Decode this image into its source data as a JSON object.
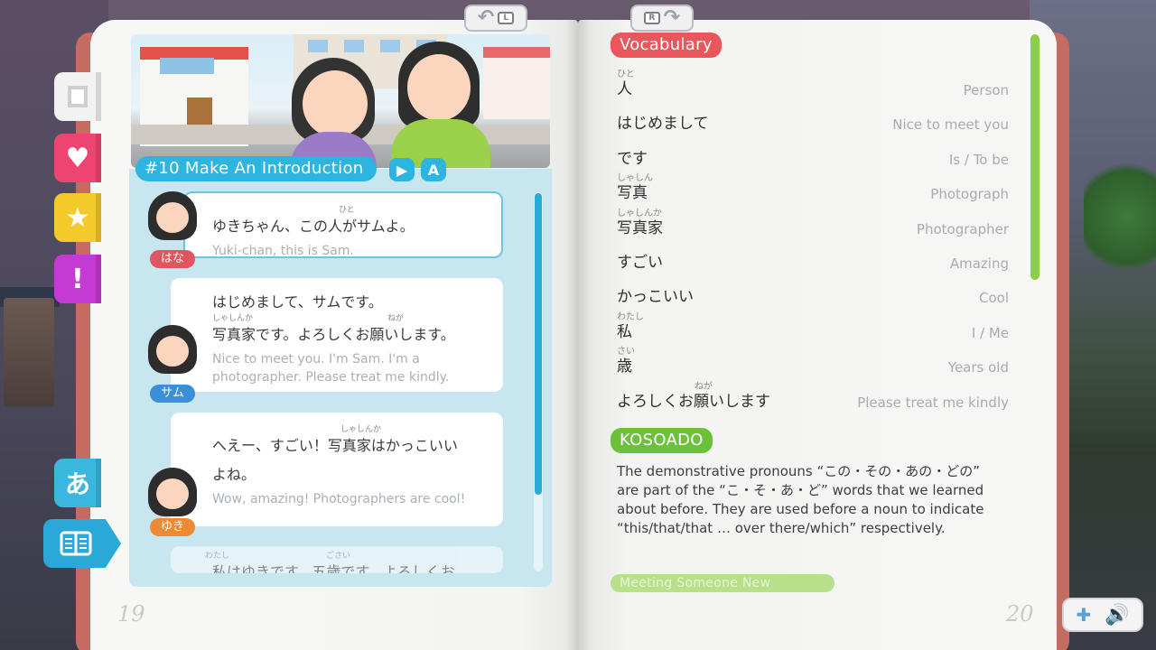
{
  "nav": {
    "prev_key": "L",
    "next_key": "R"
  },
  "side_tabs": {
    "kana_label": "あ"
  },
  "lesson": {
    "title": "#10 Make An Introduction",
    "play_label": "▶",
    "font_label": "A"
  },
  "dialogue": [
    {
      "speaker": "はな",
      "ruby": "ひと",
      "jp": "ゆきちゃん、この人がサムよ。",
      "en": "Yuki-chan, this is Sam."
    },
    {
      "speaker": "サム",
      "jp_line1": "はじめまして、サムです。",
      "ruby_a": "しゃしんか",
      "ruby_b": "ねが",
      "jp_line2": "写真家です。よろしくお願いします。",
      "en": "Nice to meet you. I'm Sam. I'm a photographer. Please treat me kindly."
    },
    {
      "speaker": "ゆき",
      "ruby": "しゃしんか",
      "jp_line1": "へえー、すごい！写真家はかっこいい",
      "jp_line2": "よね。",
      "en": "Wow, amazing! Photographers are cool!"
    },
    {
      "ruby_a": "わたし",
      "ruby_b": "ごさい",
      "jp": "私はゆきです。五歳です。よろしくお"
    }
  ],
  "vocabulary": {
    "heading": "Vocabulary",
    "items": [
      {
        "ruby": "ひと",
        "jp": "人",
        "en": "Person"
      },
      {
        "ruby": "",
        "jp": "はじめまして",
        "en": "Nice to meet you"
      },
      {
        "ruby": "",
        "jp": "です",
        "en": "Is / To be"
      },
      {
        "ruby": "しゃしん",
        "jp": "写真",
        "en": "Photograph"
      },
      {
        "ruby": "しゃしんか",
        "jp": "写真家",
        "en": "Photographer"
      },
      {
        "ruby": "",
        "jp": "すごい",
        "en": "Amazing"
      },
      {
        "ruby": "",
        "jp": "かっこいい",
        "en": "Cool"
      },
      {
        "ruby": "わたし",
        "jp": "私",
        "en": "I / Me"
      },
      {
        "ruby": "さい",
        "jp": "歳",
        "en": "Years old"
      },
      {
        "ruby": "ねが",
        "jp": "よろしくお願いします",
        "en": "Please treat me kindly"
      }
    ]
  },
  "kosoado": {
    "heading": "KOSOADO",
    "text": "The demonstrative pronouns “この・その・あの・どの” are part of the “こ・そ・あ・ど” words that we learned about before. They are used before a noun to indicate “this/that/that … over there/which” respectively."
  },
  "next_section": {
    "heading": "Meeting Someone New"
  },
  "pages": {
    "left": "19",
    "right": "20"
  },
  "colors": {
    "vocab_pill": "#e9565c",
    "kosoado_pill": "#6cc13a",
    "lesson_blue": "#2eb5df",
    "book_cover": "#c56b62"
  },
  "scroll": {
    "dialogue_visible_fraction": 0.8,
    "vocab_visible_fraction": 0.45
  }
}
